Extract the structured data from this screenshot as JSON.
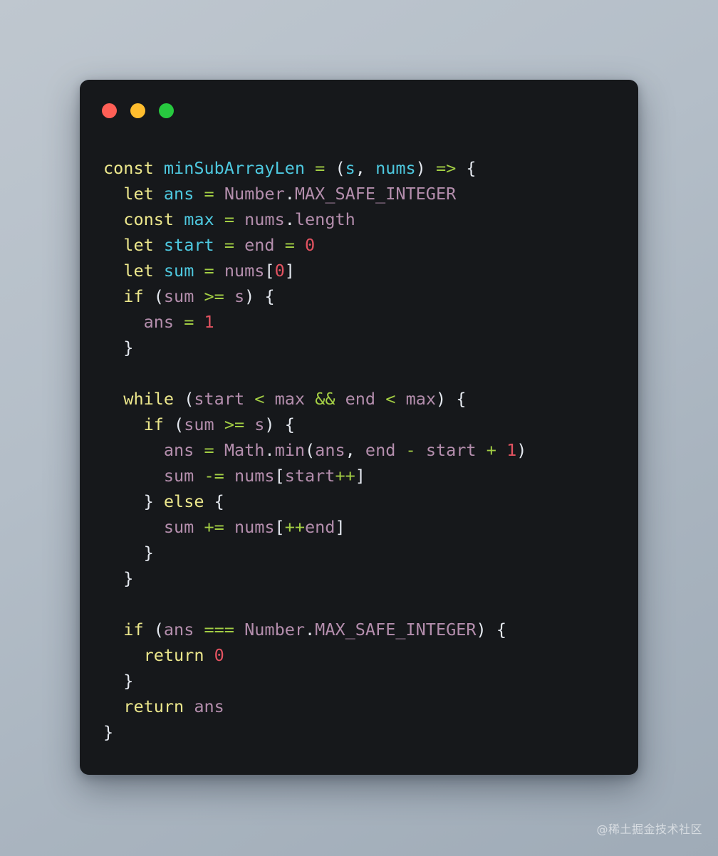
{
  "window": {
    "background_color": "#16181b",
    "traffic_lights": [
      {
        "name": "close",
        "color": "#ff5f56"
      },
      {
        "name": "minimize",
        "color": "#ffbd2e"
      },
      {
        "name": "maximize",
        "color": "#27c93f"
      }
    ]
  },
  "theme": {
    "keyword": "#ece78c",
    "declaration": "#4ec9e0",
    "variable": "#b48ead",
    "operator": "#a3ce44",
    "number": "#e35361",
    "punctuation": "#e5e9f0",
    "page_background": "#b4bec8"
  },
  "watermark": {
    "text": "@稀土掘金技术社区"
  },
  "code": {
    "language": "javascript",
    "plain_text": "const minSubArrayLen = (s, nums) => {\n  let ans = Number.MAX_SAFE_INTEGER\n  const max = nums.length\n  let start = end = 0\n  let sum = nums[0]\n  if (sum >= s) {\n    ans = 1\n  }\n\n  while (start < max && end < max) {\n    if (sum >= s) {\n      ans = Math.min(ans, end - start + 1)\n      sum -= nums[start++]\n    } else {\n      sum += nums[++end]\n    }\n  }\n\n  if (ans === Number.MAX_SAFE_INTEGER) {\n    return 0\n  }\n  return ans\n}",
    "lines": [
      {
        "indent": 0,
        "tokens": [
          {
            "t": "const",
            "c": "kw"
          },
          {
            "t": " ",
            "c": "pun"
          },
          {
            "t": "minSubArrayLen",
            "c": "decl"
          },
          {
            "t": " ",
            "c": "pun"
          },
          {
            "t": "=",
            "c": "op"
          },
          {
            "t": " ",
            "c": "pun"
          },
          {
            "t": "(",
            "c": "pun"
          },
          {
            "t": "s",
            "c": "decl"
          },
          {
            "t": ", ",
            "c": "pun"
          },
          {
            "t": "nums",
            "c": "decl"
          },
          {
            "t": ")",
            "c": "pun"
          },
          {
            "t": " ",
            "c": "pun"
          },
          {
            "t": "=>",
            "c": "op"
          },
          {
            "t": " ",
            "c": "pun"
          },
          {
            "t": "{",
            "c": "pun"
          }
        ]
      },
      {
        "indent": 1,
        "tokens": [
          {
            "t": "let",
            "c": "kw"
          },
          {
            "t": " ",
            "c": "pun"
          },
          {
            "t": "ans",
            "c": "decl"
          },
          {
            "t": " ",
            "c": "pun"
          },
          {
            "t": "=",
            "c": "op"
          },
          {
            "t": " ",
            "c": "pun"
          },
          {
            "t": "Number",
            "c": "var"
          },
          {
            "t": ".",
            "c": "pun"
          },
          {
            "t": "MAX_SAFE_INTEGER",
            "c": "var"
          }
        ]
      },
      {
        "indent": 1,
        "tokens": [
          {
            "t": "const",
            "c": "kw"
          },
          {
            "t": " ",
            "c": "pun"
          },
          {
            "t": "max",
            "c": "decl"
          },
          {
            "t": " ",
            "c": "pun"
          },
          {
            "t": "=",
            "c": "op"
          },
          {
            "t": " ",
            "c": "pun"
          },
          {
            "t": "nums",
            "c": "var"
          },
          {
            "t": ".",
            "c": "pun"
          },
          {
            "t": "length",
            "c": "var"
          }
        ]
      },
      {
        "indent": 1,
        "tokens": [
          {
            "t": "let",
            "c": "kw"
          },
          {
            "t": " ",
            "c": "pun"
          },
          {
            "t": "start",
            "c": "decl"
          },
          {
            "t": " ",
            "c": "pun"
          },
          {
            "t": "=",
            "c": "op"
          },
          {
            "t": " ",
            "c": "pun"
          },
          {
            "t": "end",
            "c": "var"
          },
          {
            "t": " ",
            "c": "pun"
          },
          {
            "t": "=",
            "c": "op"
          },
          {
            "t": " ",
            "c": "pun"
          },
          {
            "t": "0",
            "c": "num"
          }
        ]
      },
      {
        "indent": 1,
        "tokens": [
          {
            "t": "let",
            "c": "kw"
          },
          {
            "t": " ",
            "c": "pun"
          },
          {
            "t": "sum",
            "c": "decl"
          },
          {
            "t": " ",
            "c": "pun"
          },
          {
            "t": "=",
            "c": "op"
          },
          {
            "t": " ",
            "c": "pun"
          },
          {
            "t": "nums",
            "c": "var"
          },
          {
            "t": "[",
            "c": "pun"
          },
          {
            "t": "0",
            "c": "num"
          },
          {
            "t": "]",
            "c": "pun"
          }
        ]
      },
      {
        "indent": 1,
        "tokens": [
          {
            "t": "if",
            "c": "kw"
          },
          {
            "t": " ",
            "c": "pun"
          },
          {
            "t": "(",
            "c": "pun"
          },
          {
            "t": "sum",
            "c": "var"
          },
          {
            "t": " ",
            "c": "pun"
          },
          {
            "t": ">=",
            "c": "op"
          },
          {
            "t": " ",
            "c": "pun"
          },
          {
            "t": "s",
            "c": "var"
          },
          {
            "t": ")",
            "c": "pun"
          },
          {
            "t": " ",
            "c": "pun"
          },
          {
            "t": "{",
            "c": "pun"
          }
        ]
      },
      {
        "indent": 2,
        "tokens": [
          {
            "t": "ans",
            "c": "var"
          },
          {
            "t": " ",
            "c": "pun"
          },
          {
            "t": "=",
            "c": "op"
          },
          {
            "t": " ",
            "c": "pun"
          },
          {
            "t": "1",
            "c": "num"
          }
        ]
      },
      {
        "indent": 1,
        "tokens": [
          {
            "t": "}",
            "c": "pun"
          }
        ]
      },
      {
        "indent": 0,
        "tokens": []
      },
      {
        "indent": 1,
        "tokens": [
          {
            "t": "while",
            "c": "kw"
          },
          {
            "t": " ",
            "c": "pun"
          },
          {
            "t": "(",
            "c": "pun"
          },
          {
            "t": "start",
            "c": "var"
          },
          {
            "t": " ",
            "c": "pun"
          },
          {
            "t": "<",
            "c": "op"
          },
          {
            "t": " ",
            "c": "pun"
          },
          {
            "t": "max",
            "c": "var"
          },
          {
            "t": " ",
            "c": "pun"
          },
          {
            "t": "&&",
            "c": "op"
          },
          {
            "t": " ",
            "c": "pun"
          },
          {
            "t": "end",
            "c": "var"
          },
          {
            "t": " ",
            "c": "pun"
          },
          {
            "t": "<",
            "c": "op"
          },
          {
            "t": " ",
            "c": "pun"
          },
          {
            "t": "max",
            "c": "var"
          },
          {
            "t": ")",
            "c": "pun"
          },
          {
            "t": " ",
            "c": "pun"
          },
          {
            "t": "{",
            "c": "pun"
          }
        ]
      },
      {
        "indent": 2,
        "tokens": [
          {
            "t": "if",
            "c": "kw"
          },
          {
            "t": " ",
            "c": "pun"
          },
          {
            "t": "(",
            "c": "pun"
          },
          {
            "t": "sum",
            "c": "var"
          },
          {
            "t": " ",
            "c": "pun"
          },
          {
            "t": ">=",
            "c": "op"
          },
          {
            "t": " ",
            "c": "pun"
          },
          {
            "t": "s",
            "c": "var"
          },
          {
            "t": ")",
            "c": "pun"
          },
          {
            "t": " ",
            "c": "pun"
          },
          {
            "t": "{",
            "c": "pun"
          }
        ]
      },
      {
        "indent": 3,
        "tokens": [
          {
            "t": "ans",
            "c": "var"
          },
          {
            "t": " ",
            "c": "pun"
          },
          {
            "t": "=",
            "c": "op"
          },
          {
            "t": " ",
            "c": "pun"
          },
          {
            "t": "Math",
            "c": "var"
          },
          {
            "t": ".",
            "c": "pun"
          },
          {
            "t": "min",
            "c": "var"
          },
          {
            "t": "(",
            "c": "pun"
          },
          {
            "t": "ans",
            "c": "var"
          },
          {
            "t": ", ",
            "c": "pun"
          },
          {
            "t": "end",
            "c": "var"
          },
          {
            "t": " ",
            "c": "pun"
          },
          {
            "t": "-",
            "c": "op"
          },
          {
            "t": " ",
            "c": "pun"
          },
          {
            "t": "start",
            "c": "var"
          },
          {
            "t": " ",
            "c": "pun"
          },
          {
            "t": "+",
            "c": "op"
          },
          {
            "t": " ",
            "c": "pun"
          },
          {
            "t": "1",
            "c": "num"
          },
          {
            "t": ")",
            "c": "pun"
          }
        ]
      },
      {
        "indent": 3,
        "tokens": [
          {
            "t": "sum",
            "c": "var"
          },
          {
            "t": " ",
            "c": "pun"
          },
          {
            "t": "-=",
            "c": "op"
          },
          {
            "t": " ",
            "c": "pun"
          },
          {
            "t": "nums",
            "c": "var"
          },
          {
            "t": "[",
            "c": "pun"
          },
          {
            "t": "start",
            "c": "var"
          },
          {
            "t": "++",
            "c": "op"
          },
          {
            "t": "]",
            "c": "pun"
          }
        ]
      },
      {
        "indent": 2,
        "tokens": [
          {
            "t": "}",
            "c": "pun"
          },
          {
            "t": " ",
            "c": "pun"
          },
          {
            "t": "else",
            "c": "kw"
          },
          {
            "t": " ",
            "c": "pun"
          },
          {
            "t": "{",
            "c": "pun"
          }
        ]
      },
      {
        "indent": 3,
        "tokens": [
          {
            "t": "sum",
            "c": "var"
          },
          {
            "t": " ",
            "c": "pun"
          },
          {
            "t": "+=",
            "c": "op"
          },
          {
            "t": " ",
            "c": "pun"
          },
          {
            "t": "nums",
            "c": "var"
          },
          {
            "t": "[",
            "c": "pun"
          },
          {
            "t": "++",
            "c": "op"
          },
          {
            "t": "end",
            "c": "var"
          },
          {
            "t": "]",
            "c": "pun"
          }
        ]
      },
      {
        "indent": 2,
        "tokens": [
          {
            "t": "}",
            "c": "pun"
          }
        ]
      },
      {
        "indent": 1,
        "tokens": [
          {
            "t": "}",
            "c": "pun"
          }
        ]
      },
      {
        "indent": 0,
        "tokens": []
      },
      {
        "indent": 1,
        "tokens": [
          {
            "t": "if",
            "c": "kw"
          },
          {
            "t": " ",
            "c": "pun"
          },
          {
            "t": "(",
            "c": "pun"
          },
          {
            "t": "ans",
            "c": "var"
          },
          {
            "t": " ",
            "c": "pun"
          },
          {
            "t": "===",
            "c": "op"
          },
          {
            "t": " ",
            "c": "pun"
          },
          {
            "t": "Number",
            "c": "var"
          },
          {
            "t": ".",
            "c": "pun"
          },
          {
            "t": "MAX_SAFE_INTEGER",
            "c": "var"
          },
          {
            "t": ")",
            "c": "pun"
          },
          {
            "t": " ",
            "c": "pun"
          },
          {
            "t": "{",
            "c": "pun"
          }
        ]
      },
      {
        "indent": 2,
        "tokens": [
          {
            "t": "return",
            "c": "kw"
          },
          {
            "t": " ",
            "c": "pun"
          },
          {
            "t": "0",
            "c": "num"
          }
        ]
      },
      {
        "indent": 1,
        "tokens": [
          {
            "t": "}",
            "c": "pun"
          }
        ]
      },
      {
        "indent": 1,
        "tokens": [
          {
            "t": "return",
            "c": "kw"
          },
          {
            "t": " ",
            "c": "pun"
          },
          {
            "t": "ans",
            "c": "var"
          }
        ]
      },
      {
        "indent": 0,
        "tokens": [
          {
            "t": "}",
            "c": "pun"
          }
        ]
      }
    ]
  }
}
